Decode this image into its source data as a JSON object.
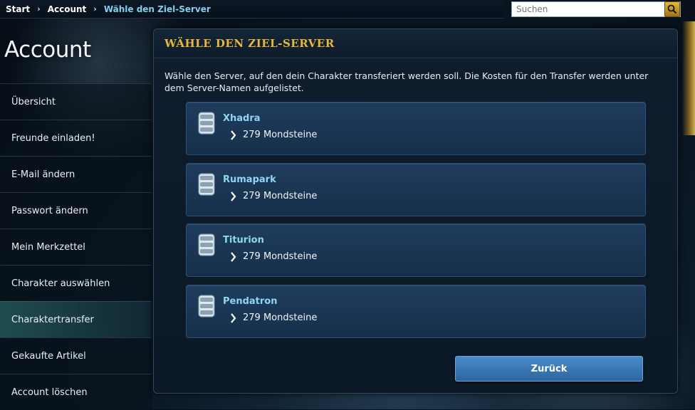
{
  "breadcrumb": {
    "items": [
      "Start",
      "Account",
      "Wähle den Ziel-Server"
    ]
  },
  "search": {
    "placeholder": "Suchen"
  },
  "sidebar": {
    "title": "Account",
    "items": [
      {
        "label": "Übersicht"
      },
      {
        "label": "Freunde einladen!"
      },
      {
        "label": "E-Mail ändern"
      },
      {
        "label": "Passwort ändern"
      },
      {
        "label": "Mein Merkzettel"
      },
      {
        "label": "Charakter auswählen"
      },
      {
        "label": "Charaktertransfer",
        "active": true
      },
      {
        "label": "Gekaufte Artikel"
      },
      {
        "label": "Account löschen"
      }
    ]
  },
  "panel": {
    "title": "WÄHLE DEN ZIEL-SERVER",
    "intro": "Wähle den Server, auf den dein Charakter transferiert werden soll. Die Kosten für den Transfer werden unter dem Server-Namen aufgelistet.",
    "servers": [
      {
        "name": "Xhadra",
        "cost": "279 Mondsteine"
      },
      {
        "name": "Rumapark",
        "cost": "279 Mondsteine"
      },
      {
        "name": "Titurion",
        "cost": "279 Mondsteine"
      },
      {
        "name": "Pendatron",
        "cost": "279 Mondsteine"
      }
    ],
    "back_label": "Zurück"
  },
  "icons": {
    "search": "search-icon",
    "server": "database-icon",
    "arrow": "chevron-right-icon"
  },
  "colors": {
    "accent_gold": "#e8b83a",
    "link_cyan": "#8fd6f2",
    "button_blue": "#3a7ab6"
  }
}
